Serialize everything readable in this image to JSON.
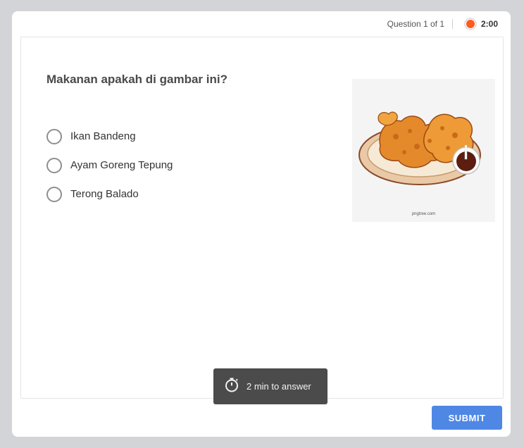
{
  "header": {
    "question_counter": "Question 1 of 1",
    "timer": "2:00",
    "timer_color": "#ff5a1f"
  },
  "question": {
    "text": "Makanan apakah di gambar ini?",
    "options": [
      {
        "label": "Ikan Bandeng"
      },
      {
        "label": "Ayam Goreng Tepung"
      },
      {
        "label": "Terong Balado"
      }
    ],
    "image": {
      "icon": "fried-chicken-plate",
      "watermark": "pngtree.com"
    }
  },
  "toast": {
    "icon": "stopwatch-icon",
    "text": "2 min to answer"
  },
  "footer": {
    "submit_label": "SUBMIT",
    "accent": "#4f87e5"
  }
}
